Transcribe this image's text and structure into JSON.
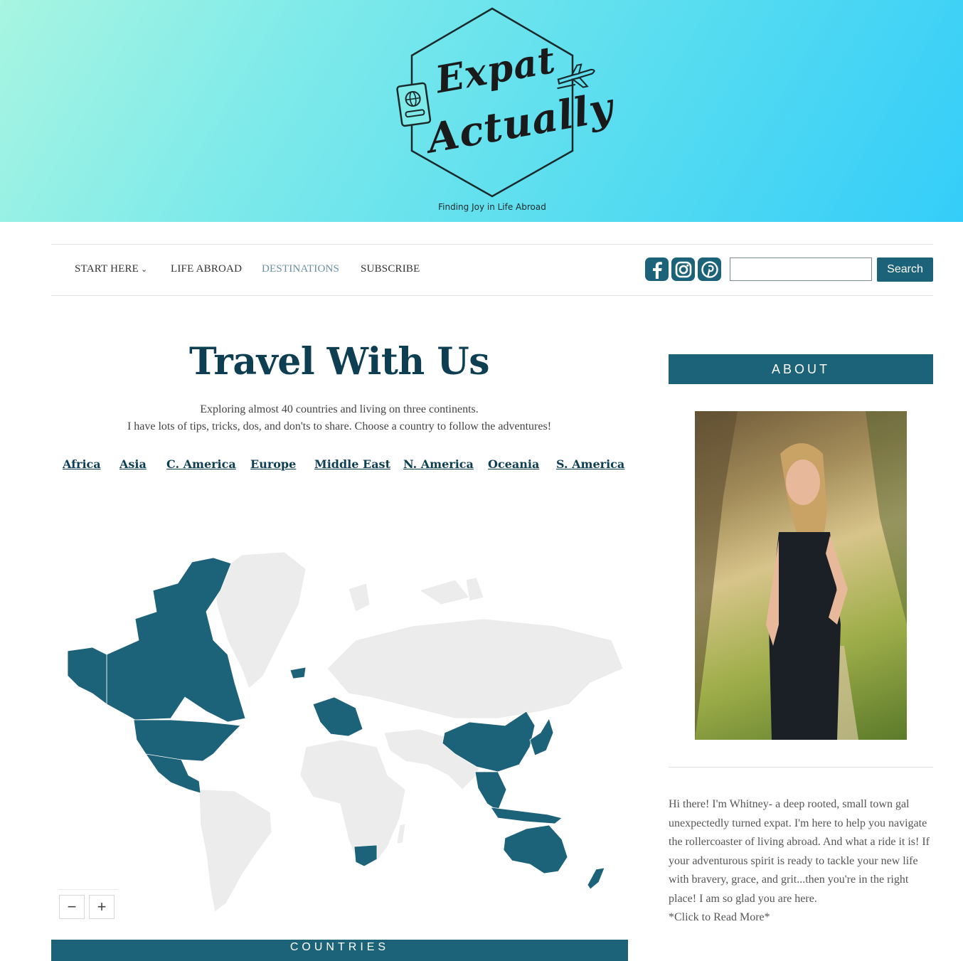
{
  "header": {
    "logo_line1": "Expat",
    "logo_line2": "Actually",
    "tagline": "Finding Joy in Life Abroad"
  },
  "nav": {
    "items": [
      {
        "label": "START HERE",
        "has_dropdown": true
      },
      {
        "label": "LIFE ABROAD"
      },
      {
        "label": "DESTINATIONS",
        "active": true
      },
      {
        "label": "SUBSCRIBE"
      }
    ],
    "social": [
      "facebook-icon",
      "instagram-icon",
      "pinterest-icon"
    ],
    "search": {
      "value": "",
      "button_label": "Search"
    }
  },
  "main": {
    "title": "Travel With Us",
    "intro_line1": "Exploring almost 40 countries and living on three continents.",
    "intro_line2": "I have lots of tips, tricks, dos, and don'ts to share. Choose a country to follow the adventures!",
    "regions": [
      "Africa",
      "Asia",
      "C. America",
      "Europe",
      "Middle East",
      "N. America",
      "Oceania",
      "S. America"
    ],
    "map": {
      "visited_color": "#1c6278",
      "unvisited_color": "#ececec",
      "visited_regions": [
        "Canada",
        "United States",
        "Alaska",
        "Mexico",
        "Central America",
        "Iceland",
        "Western Europe",
        "China",
        "Japan",
        "Korea",
        "Southeast Asia",
        "Indonesia",
        "Australia",
        "New Zealand",
        "South Africa"
      ]
    },
    "zoom_out": "−",
    "zoom_in": "+",
    "countries_heading": "COUNTRIES"
  },
  "sidebar": {
    "about_heading": "ABOUT",
    "about_text": "Hi there! I'm Whitney- a deep rooted, small town gal unexpectedly turned expat. I'm here to help you navigate the rollercoaster of living abroad. And what a ride it is! If your adventurous spirit is ready to tackle your new life with bravery, grace, and grit...then you're in the right place! I am so glad you are here.",
    "read_more": "*Click to Read More*"
  },
  "colors": {
    "brand": "#1c6278",
    "title": "#0d3e52",
    "active_nav": "#6a8ea0"
  }
}
